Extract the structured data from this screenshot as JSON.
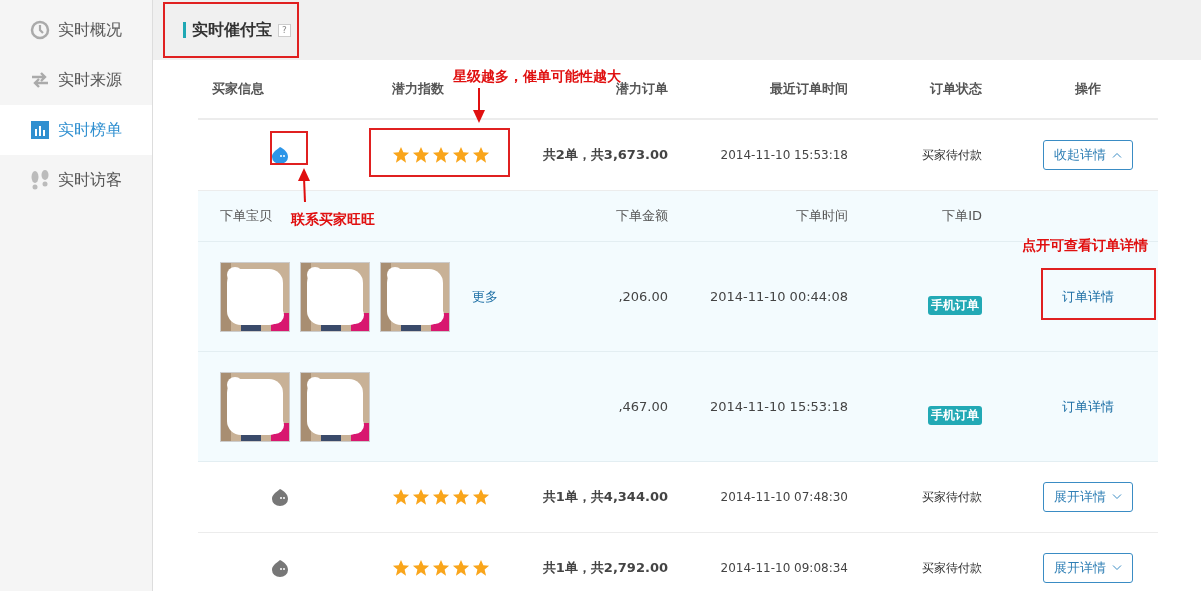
{
  "sidebar": {
    "items": [
      {
        "label": "实时概况",
        "selected": false
      },
      {
        "label": "实时来源",
        "selected": false
      },
      {
        "label": "实时榜单",
        "selected": true
      },
      {
        "label": "实时访客",
        "selected": false
      }
    ]
  },
  "header": {
    "title": "实时催付宝",
    "help": "?"
  },
  "table": {
    "columns": [
      "买家信息",
      "潜力指数",
      "潜力订单",
      "最近订单时间",
      "订单状态",
      "操作"
    ],
    "rows": [
      {
        "online": true,
        "stars": 5,
        "orders_total": "共2单，共3,673.00",
        "last_order_time": "2014-11-10 15:53:18",
        "status": "买家待付款",
        "action": {
          "label": "收起详情",
          "expanded": true
        },
        "details": {
          "columns": [
            "下单宝贝",
            "下单金额",
            "下单时间",
            "下单ID"
          ],
          "items": [
            {
              "more": "更多",
              "amount": ",206.00",
              "time": "2014-11-10 00:44:08",
              "tag": "手机订单",
              "link": "订单详情"
            },
            {
              "amount": ",467.00",
              "time": "2014-11-10 15:53:18",
              "tag": "手机订单",
              "link": "订单详情"
            }
          ]
        }
      },
      {
        "online": false,
        "stars": 5,
        "orders_total": "共1单，共4,344.00",
        "last_order_time": "2014-11-10 07:48:30",
        "status": "买家待付款",
        "action": {
          "label": "展开详情",
          "expanded": false
        }
      },
      {
        "online": false,
        "stars": 5,
        "orders_total": "共1单，共2,792.00",
        "last_order_time": "2014-11-10 09:08:34",
        "status": "买家待付款",
        "action": {
          "label": "展开详情",
          "expanded": false
        }
      }
    ]
  },
  "annotations": [
    {
      "text": "星级越多，催单可能性越大"
    },
    {
      "text": "联系买家旺旺"
    },
    {
      "text": "点开可查看订单详情"
    }
  ]
}
